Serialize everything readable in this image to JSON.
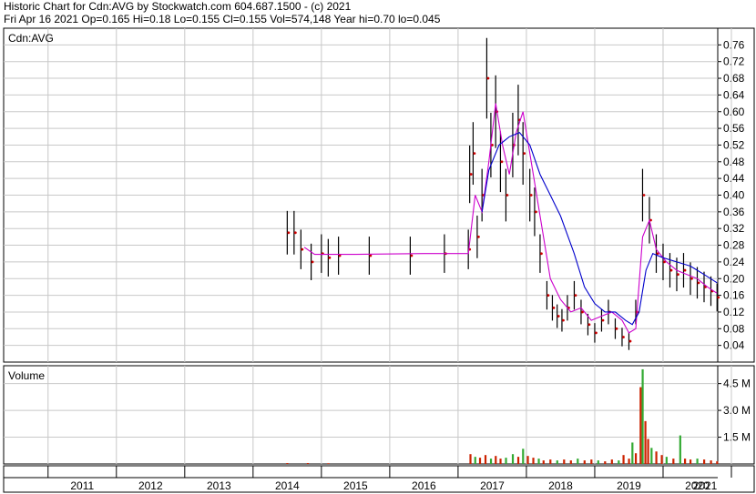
{
  "header": {
    "line1": "Historic Chart for Cdn:AVG by Stockwatch.com 604.687.1500 - (c) 2021",
    "line2": "Fri Apr 16 2021  Op=0.165  Hi=0.18  Lo=0.155  Cl=0.155  Vol=574,148  Year hi=0.70  lo=0.045"
  },
  "chart_data": [
    {
      "type": "line",
      "panel": "price",
      "title": "Cdn:AVG",
      "ylim": [
        0,
        0.8
      ],
      "yticks": [
        0.04,
        0.08,
        0.12,
        0.16,
        0.2,
        0.24,
        0.28,
        0.32,
        0.36,
        0.4,
        0.44,
        0.48,
        0.52,
        0.56,
        0.6,
        0.64,
        0.68,
        0.72,
        0.76
      ],
      "ytick_labels": [
        "0.04",
        "0.08",
        "0.12",
        "0.16",
        "0.20",
        "0.24",
        "0.28",
        "0.32",
        "0.36",
        "0.40",
        "0.44",
        "0.48",
        "0.52",
        "0.56",
        "0.60",
        "0.64",
        "0.68",
        "0.72",
        "0.76"
      ],
      "grid": true,
      "colors": {
        "price_bars": "#000000",
        "close_dots": "#cc0000",
        "ma_short": "#cc00cc",
        "ma_long": "#0000cc",
        "grid": "#c8c8c8"
      },
      "series": [
        {
          "role": "price",
          "x": [
            2015.0,
            2015.1,
            2015.2,
            2015.35,
            2015.5,
            2015.6,
            2015.75,
            2016.2,
            2016.8,
            2017.3,
            2017.65,
            2017.67,
            2017.72,
            2017.78,
            2017.85,
            2017.92,
            2017.98,
            2018.05,
            2018.12,
            2018.2,
            2018.3,
            2018.38,
            2018.45,
            2018.55,
            2018.62,
            2018.7,
            2018.8,
            2018.88,
            2018.95,
            2019.02,
            2019.1,
            2019.2,
            2019.3,
            2019.4,
            2019.5,
            2019.6,
            2019.7,
            2019.8,
            2019.9,
            2020.0,
            2020.1,
            2020.2,
            2020.3,
            2020.4,
            2020.5,
            2020.6,
            2020.7,
            2020.8,
            2020.9,
            2021.0,
            2021.1,
            2021.2,
            2021.29
          ],
          "y": [
            0.31,
            0.31,
            0.27,
            0.24,
            0.26,
            0.25,
            0.255,
            0.255,
            0.255,
            0.26,
            0.27,
            0.45,
            0.5,
            0.3,
            0.4,
            0.68,
            0.52,
            0.6,
            0.48,
            0.4,
            0.52,
            0.58,
            0.5,
            0.4,
            0.36,
            0.26,
            0.16,
            0.13,
            0.11,
            0.1,
            0.13,
            0.16,
            0.12,
            0.09,
            0.07,
            0.1,
            0.12,
            0.08,
            0.06,
            0.05,
            0.12,
            0.4,
            0.34,
            0.26,
            0.24,
            0.22,
            0.21,
            0.22,
            0.2,
            0.19,
            0.18,
            0.17,
            0.155
          ]
        },
        {
          "role": "moving-average-short",
          "x": [
            2015.25,
            2015.4,
            2016.0,
            2017.0,
            2017.65,
            2017.75,
            2017.85,
            2017.95,
            2018.05,
            2018.15,
            2018.25,
            2018.35,
            2018.45,
            2018.55,
            2018.65,
            2018.75,
            2018.85,
            2019.0,
            2019.15,
            2019.3,
            2019.45,
            2019.6,
            2019.75,
            2019.9,
            2020.0,
            2020.1,
            2020.2,
            2020.3,
            2020.4,
            2020.55,
            2020.7,
            2020.85,
            2021.0,
            2021.15,
            2021.29
          ],
          "y": [
            0.275,
            0.258,
            0.258,
            0.26,
            0.26,
            0.4,
            0.36,
            0.48,
            0.62,
            0.52,
            0.45,
            0.55,
            0.6,
            0.5,
            0.4,
            0.3,
            0.2,
            0.15,
            0.12,
            0.13,
            0.1,
            0.11,
            0.12,
            0.1,
            0.07,
            0.08,
            0.3,
            0.34,
            0.27,
            0.24,
            0.22,
            0.21,
            0.2,
            0.18,
            0.165
          ]
        },
        {
          "role": "moving-average-long",
          "x": [
            2017.85,
            2017.95,
            2018.1,
            2018.25,
            2018.4,
            2018.55,
            2018.7,
            2018.85,
            2019.0,
            2019.2,
            2019.35,
            2019.5,
            2019.65,
            2019.8,
            2019.95,
            2020.05,
            2020.15,
            2020.25,
            2020.35,
            2020.5,
            2020.7,
            2020.9,
            2021.1,
            2021.29
          ],
          "y": [
            0.36,
            0.46,
            0.52,
            0.54,
            0.55,
            0.52,
            0.45,
            0.4,
            0.35,
            0.26,
            0.18,
            0.14,
            0.12,
            0.12,
            0.1,
            0.09,
            0.12,
            0.22,
            0.26,
            0.25,
            0.24,
            0.23,
            0.21,
            0.19
          ]
        }
      ]
    },
    {
      "type": "bar",
      "panel": "volume",
      "title": "Volume",
      "ylim": [
        0,
        5.5
      ],
      "yticks": [
        1.5,
        3.0,
        4.5
      ],
      "ytick_labels": [
        "1.5 M",
        "3.0 M",
        "4.5 M"
      ],
      "x_categories": [
        "2011",
        "2012",
        "2013",
        "2014",
        "2015",
        "2016",
        "2017",
        "2018",
        "2019",
        "2020",
        "2021"
      ],
      "grid": true,
      "colors": {
        "up": "#33aa33",
        "down": "#cc2200"
      },
      "bars": [
        {
          "x": 2015.0,
          "v": 0.05,
          "dir": "down"
        },
        {
          "x": 2015.3,
          "v": 0.05,
          "dir": "down"
        },
        {
          "x": 2015.6,
          "v": 0.04,
          "dir": "down"
        },
        {
          "x": 2017.68,
          "v": 0.55,
          "dir": "down"
        },
        {
          "x": 2017.75,
          "v": 0.4,
          "dir": "up"
        },
        {
          "x": 2017.82,
          "v": 0.35,
          "dir": "down"
        },
        {
          "x": 2017.9,
          "v": 0.5,
          "dir": "down"
        },
        {
          "x": 2017.98,
          "v": 0.3,
          "dir": "up"
        },
        {
          "x": 2018.05,
          "v": 0.45,
          "dir": "down"
        },
        {
          "x": 2018.12,
          "v": 0.3,
          "dir": "down"
        },
        {
          "x": 2018.2,
          "v": 0.35,
          "dir": "up"
        },
        {
          "x": 2018.3,
          "v": 0.55,
          "dir": "up"
        },
        {
          "x": 2018.38,
          "v": 0.4,
          "dir": "down"
        },
        {
          "x": 2018.45,
          "v": 0.85,
          "dir": "up"
        },
        {
          "x": 2018.52,
          "v": 0.45,
          "dir": "down"
        },
        {
          "x": 2018.6,
          "v": 0.35,
          "dir": "down"
        },
        {
          "x": 2018.68,
          "v": 0.3,
          "dir": "up"
        },
        {
          "x": 2018.75,
          "v": 0.2,
          "dir": "down"
        },
        {
          "x": 2018.85,
          "v": 0.25,
          "dir": "down"
        },
        {
          "x": 2018.95,
          "v": 0.2,
          "dir": "up"
        },
        {
          "x": 2019.05,
          "v": 0.25,
          "dir": "down"
        },
        {
          "x": 2019.15,
          "v": 0.2,
          "dir": "down"
        },
        {
          "x": 2019.25,
          "v": 0.3,
          "dir": "up"
        },
        {
          "x": 2019.35,
          "v": 0.2,
          "dir": "down"
        },
        {
          "x": 2019.45,
          "v": 0.25,
          "dir": "down"
        },
        {
          "x": 2019.55,
          "v": 0.2,
          "dir": "up"
        },
        {
          "x": 2019.65,
          "v": 0.15,
          "dir": "down"
        },
        {
          "x": 2019.75,
          "v": 0.25,
          "dir": "down"
        },
        {
          "x": 2019.85,
          "v": 0.2,
          "dir": "up"
        },
        {
          "x": 2019.92,
          "v": 0.5,
          "dir": "down"
        },
        {
          "x": 2020.0,
          "v": 0.3,
          "dir": "down"
        },
        {
          "x": 2020.05,
          "v": 1.2,
          "dir": "up"
        },
        {
          "x": 2020.1,
          "v": 0.6,
          "dir": "down"
        },
        {
          "x": 2020.17,
          "v": 4.3,
          "dir": "down"
        },
        {
          "x": 2020.2,
          "v": 5.3,
          "dir": "up"
        },
        {
          "x": 2020.24,
          "v": 2.4,
          "dir": "down"
        },
        {
          "x": 2020.28,
          "v": 1.4,
          "dir": "down"
        },
        {
          "x": 2020.33,
          "v": 0.9,
          "dir": "up"
        },
        {
          "x": 2020.4,
          "v": 0.7,
          "dir": "down"
        },
        {
          "x": 2020.48,
          "v": 0.5,
          "dir": "down"
        },
        {
          "x": 2020.55,
          "v": 0.4,
          "dir": "up"
        },
        {
          "x": 2020.65,
          "v": 0.3,
          "dir": "down"
        },
        {
          "x": 2020.75,
          "v": 1.6,
          "dir": "up"
        },
        {
          "x": 2020.82,
          "v": 0.3,
          "dir": "down"
        },
        {
          "x": 2020.9,
          "v": 0.25,
          "dir": "down"
        },
        {
          "x": 2021.0,
          "v": 0.3,
          "dir": "up"
        },
        {
          "x": 2021.1,
          "v": 0.25,
          "dir": "down"
        },
        {
          "x": 2021.2,
          "v": 0.2,
          "dir": "down"
        },
        {
          "x": 2021.29,
          "v": 0.15,
          "dir": "down"
        }
      ]
    }
  ]
}
